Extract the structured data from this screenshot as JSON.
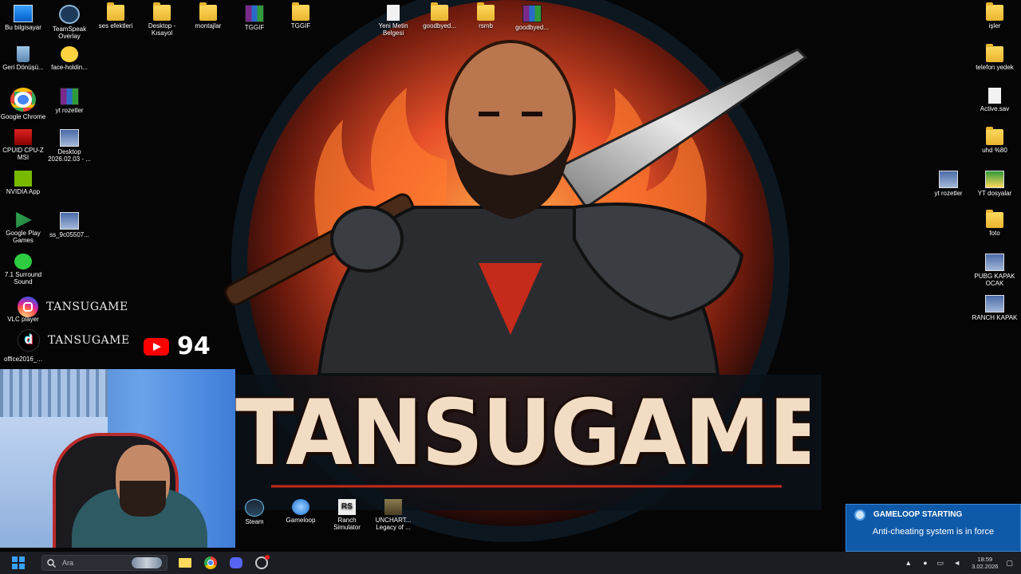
{
  "desktop_icons_left": [
    {
      "id": "bu-bilgisayar",
      "label": "Bu bilgisayar",
      "icon": "monitor-icon"
    },
    {
      "id": "teamspeak",
      "label": "TeamSpeak Overlay",
      "icon": "headset-icon"
    },
    {
      "id": "ses-efektleri",
      "label": "ses efektleri",
      "icon": "folder-icon"
    },
    {
      "id": "desktop-kisayol",
      "label": "Desktop - Kısayol",
      "icon": "folder-shortcut-icon"
    },
    {
      "id": "montajlar",
      "label": "montajlar",
      "icon": "folder-icon"
    },
    {
      "id": "tggif-1",
      "label": "TGGIF",
      "icon": "archive-icon"
    },
    {
      "id": "tggif-2",
      "label": "TGGIF",
      "icon": "folder-icon"
    },
    {
      "id": "yeni-metin",
      "label": "Yeni Metin Belgesi",
      "icon": "text-document-icon"
    },
    {
      "id": "goodbyed-1",
      "label": "goodbyed...",
      "icon": "folder-icon"
    },
    {
      "id": "rsmb",
      "label": "rsmb",
      "icon": "folder-icon"
    },
    {
      "id": "goodbyed-2",
      "label": "goodbyed...",
      "icon": "archive-icon"
    },
    {
      "id": "geri-donusum",
      "label": "Geri Dönüşü...",
      "icon": "recycle-bin-icon"
    },
    {
      "id": "face-holding",
      "label": "face-holdin...",
      "icon": "emoji-face-icon"
    },
    {
      "id": "google-chrome",
      "label": "Google Chrome",
      "icon": "chrome-icon"
    },
    {
      "id": "yt-rozetler-l",
      "label": "yt rozetler",
      "icon": "archive-icon"
    },
    {
      "id": "cpuid",
      "label": "CPUID CPU-Z MSI",
      "icon": "cpuz-icon"
    },
    {
      "id": "desktop-date",
      "label": "Desktop 2026.02.03 - ...",
      "icon": "image-file-icon"
    },
    {
      "id": "nvidia",
      "label": "NVIDIA App",
      "icon": "nvidia-icon"
    },
    {
      "id": "google-play",
      "label": "Google Play Games",
      "icon": "google-play-icon"
    },
    {
      "id": "ss-file",
      "label": "ss_9c05507...",
      "icon": "image-file-icon"
    },
    {
      "id": "surround",
      "label": "7.1 Surround Sound",
      "icon": "surround-sound-icon"
    },
    {
      "id": "vlc",
      "label": "VLC player",
      "icon": "vlc-icon"
    },
    {
      "id": "office",
      "label": "office2016_...",
      "icon": "office-icon"
    }
  ],
  "desktop_icons_right": [
    {
      "id": "isler",
      "label": "işler",
      "icon": "folder-icon"
    },
    {
      "id": "telefon-yedek",
      "label": "telefon yedek",
      "icon": "folder-icon"
    },
    {
      "id": "active-sav",
      "label": "Active.sav",
      "icon": "file-icon"
    },
    {
      "id": "uhd",
      "label": "uhd %80",
      "icon": "folder-icon"
    },
    {
      "id": "yt-rozetler-r",
      "label": "yt rozetler",
      "icon": "image-file-icon"
    },
    {
      "id": "yt-dosyalar",
      "label": "YT dosyalar",
      "icon": "image-file-icon"
    },
    {
      "id": "foto",
      "label": "foto",
      "icon": "folder-icon"
    },
    {
      "id": "pubg-kapak",
      "label": "PUBG KAPAK OCAK",
      "icon": "image-file-icon"
    },
    {
      "id": "ranch-kapak",
      "label": "RANCH KAPAK",
      "icon": "image-file-icon"
    }
  ],
  "desktop_icons_bottom": [
    {
      "id": "steam",
      "label": "Steam",
      "icon": "steam-icon"
    },
    {
      "id": "gameloop",
      "label": "Gameloop",
      "icon": "gameloop-icon"
    },
    {
      "id": "ranch-sim",
      "label": "Ranch Simulator",
      "icon": "ranch-simulator-icon"
    },
    {
      "id": "uncharted",
      "label": "UNCHART... Legacy of ...",
      "icon": "uncharted-icon"
    }
  ],
  "overlay": {
    "instagram_handle": "TANSUGAME",
    "tiktok_handle": "TANSUGAME",
    "youtube_count": "94"
  },
  "wallpaper": {
    "brand_text": "TANSUGAME"
  },
  "notification": {
    "title": "GAMELOOP STARTING",
    "message": "Anti-cheating system is in force"
  },
  "taskbar": {
    "search_placeholder": "Ara",
    "time": "18:59",
    "date": "3.02.2026"
  },
  "colors": {
    "brand_orange": "#e8502a",
    "notification_blue": "#0f5aa8",
    "taskbar_bg": "#1b1d22",
    "text_cream": "#f2dcc4"
  }
}
